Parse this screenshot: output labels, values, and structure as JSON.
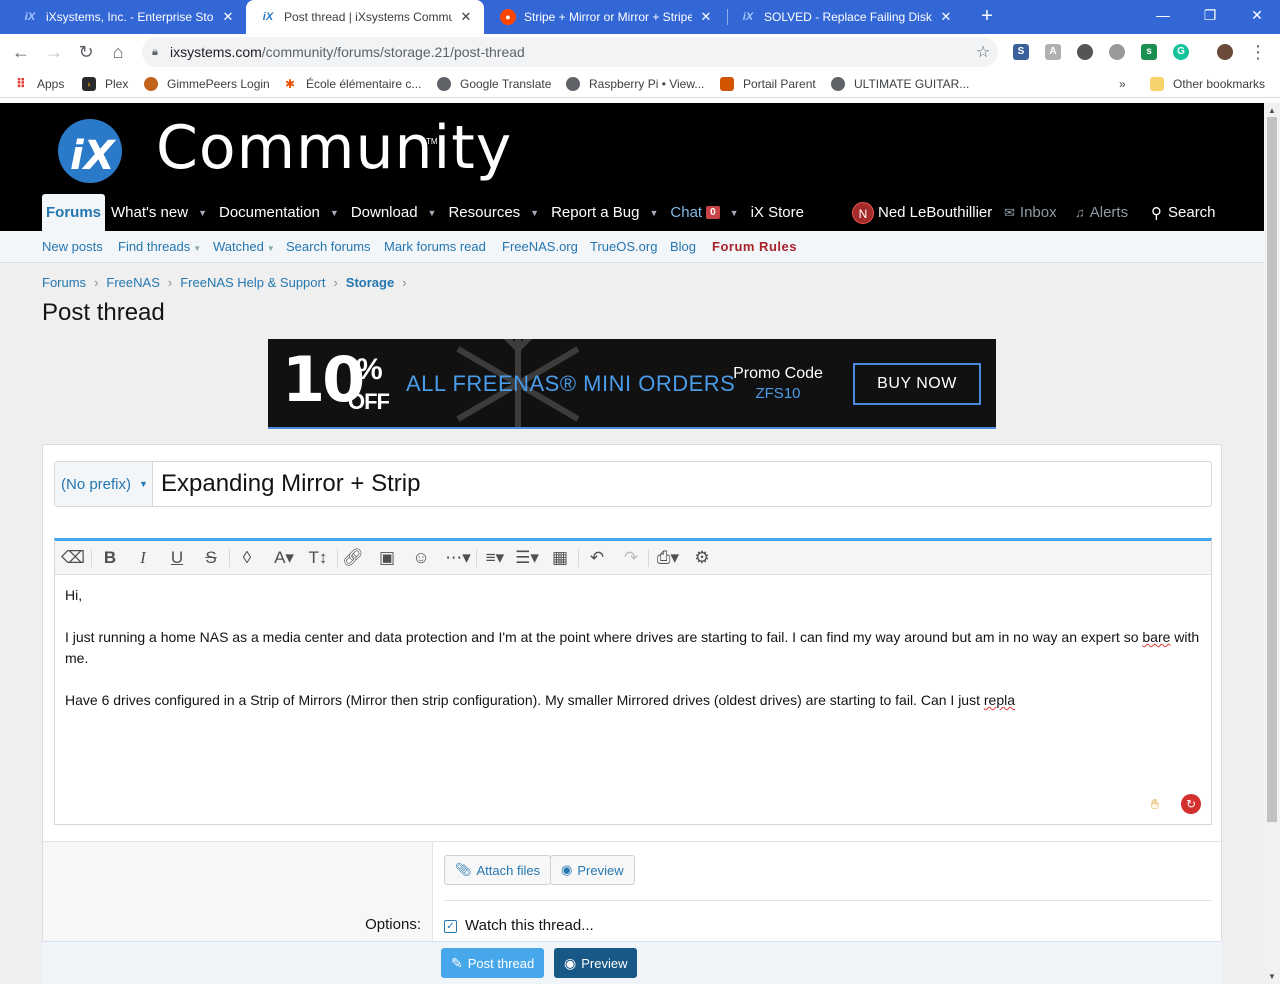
{
  "browser": {
    "tabs": [
      {
        "title": "iXsystems, Inc. - Enterprise Storag",
        "icon": "ix-favicon"
      },
      {
        "title": "Post thread | iXsystems Commun",
        "icon": "ix-favicon",
        "active": true
      },
      {
        "title": "Stripe + Mirror or Mirror + Stripe",
        "icon": "reddit-favicon"
      },
      {
        "title": "SOLVED - Replace Failing Disk wi",
        "icon": "ix-favicon"
      }
    ],
    "url_host": "ixsystems.com",
    "url_path": "/community/forums/storage.21/post-thread",
    "bookmarks": [
      {
        "label": "Apps",
        "icon": "apps-grid-icon"
      },
      {
        "label": "Plex",
        "icon": "plex-icon"
      },
      {
        "label": "GimmePeers Login",
        "icon": "gimmepeers-icon"
      },
      {
        "label": "École élémentaire c...",
        "icon": "school-icon"
      },
      {
        "label": "Google Translate",
        "icon": "globe-icon"
      },
      {
        "label": "Raspberry Pi • View...",
        "icon": "globe-icon"
      },
      {
        "label": "Portail Parent",
        "icon": "portail-icon"
      },
      {
        "label": "ULTIMATE GUITAR...",
        "icon": "globe-icon"
      }
    ],
    "bookmarks_overflow": "»",
    "other_bookmarks": "Other bookmarks"
  },
  "site": {
    "logo_text": "Community",
    "logo_mark": "iX",
    "nav": [
      {
        "label": "Forums",
        "selected": true
      },
      {
        "label": "What's new"
      },
      {
        "label": "Documentation"
      },
      {
        "label": "Download"
      },
      {
        "label": "Resources"
      },
      {
        "label": "Report a Bug"
      },
      {
        "label": "Chat"
      },
      {
        "label": "iX Store"
      }
    ],
    "chat_badge": "0",
    "user_initial": "N",
    "user_name": "Ned LeBouthillier",
    "inbox": "Inbox",
    "alerts": "Alerts",
    "search": "Search",
    "subnav": [
      "New posts",
      "Find threads",
      "Watched",
      "Search forums",
      "Mark forums read",
      "FreeNAS.org",
      "TrueOS.org",
      "Blog",
      "Forum Rules"
    ]
  },
  "breadcrumbs": [
    "Forums",
    "FreeNAS",
    "FreeNAS Help & Support",
    "Storage"
  ],
  "page_title": "Post thread",
  "banner": {
    "discount": "10",
    "percent": "%",
    "off": "OFF",
    "headline": "ALL FREENAS® MINI ORDERS",
    "promo_label": "Promo Code",
    "promo_code": "ZFS10",
    "cta": "BUY NOW"
  },
  "form": {
    "prefix": "(No prefix)",
    "title_value": "Expanding Mirror + Strip",
    "body": {
      "line1": "Hi,",
      "line2_a": "I just running a home NAS as a media center and data protection and I'm at the point where drives are starting to fail.  I can find my way around but am in no way an expert so ",
      "line2_misspelled": "bare",
      "line2_b": " with me.",
      "line3_a": "Have 6 drives configured in a Strip of Mirrors (Mirror then strip configuration).  My smaller Mirrored drives (oldest drives) are starting to fail.  Can I just ",
      "line3_misspelled": "repla"
    },
    "attach_label": "Attach files",
    "preview_label": "Preview",
    "options_label": "Options:",
    "watch_label": "Watch this thread...",
    "watch_checked": true,
    "submit_label": "Post thread",
    "footer_preview_label": "Preview"
  }
}
